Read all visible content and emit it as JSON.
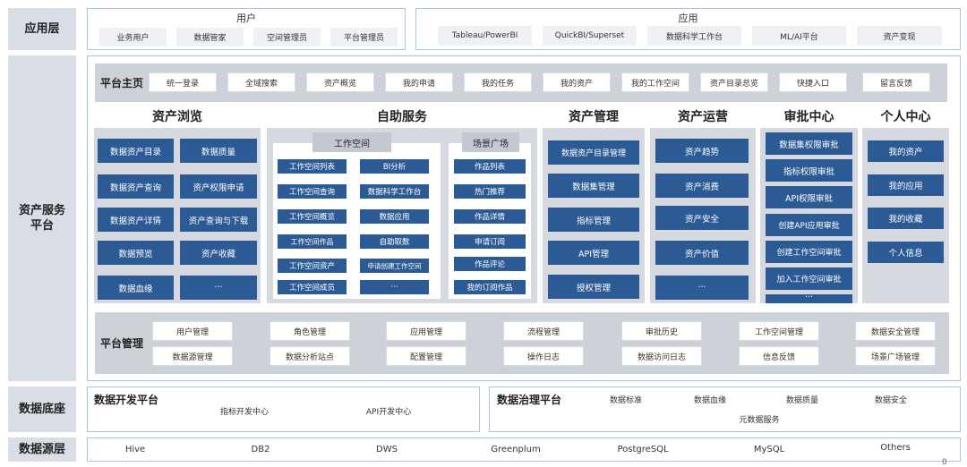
{
  "layers": {
    "app": "应用层",
    "asset_service": "资产服务\n平台",
    "data_base": "数据底座",
    "data_source": "数据源层"
  },
  "users": {
    "title": "用户",
    "items": [
      "业务用户",
      "数据管家",
      "空间管理员",
      "平台管理员"
    ]
  },
  "apps": {
    "title": "应用",
    "items": [
      "Tableau/PowerBI",
      "QuickBI/Superset",
      "数据科学工作台",
      "ML/AI平台",
      "资产变现"
    ]
  },
  "portal": {
    "title": "平台主页",
    "items": [
      "统一登录",
      "全域搜索",
      "资产概览",
      "我的申请",
      "我的任务",
      "我的资产",
      "我的工作空间",
      "资产目录总览",
      "快捷入口",
      "留言反馈"
    ]
  },
  "sections": {
    "browse": {
      "title": "资产浏览",
      "items": [
        "数据资产目录",
        "数据质量",
        "数据资产查询",
        "资产权限申请",
        "数据资产详情",
        "资产查询与下载",
        "数据预览",
        "资产收藏",
        "数据血缘",
        "···"
      ]
    },
    "self_service": {
      "title": "自助服务",
      "workspace": {
        "title": "工作空间",
        "items": [
          "工作空间列表",
          "BI分析",
          "工作空间查询",
          "数据科学工作台",
          "工作空间概览",
          "数据应用",
          "工作空间作品",
          "自助取数",
          "工作空间资产",
          "申请创建工作空间",
          "工作空间成员",
          "···"
        ]
      },
      "scene": {
        "title": "场景广场",
        "items": [
          "作品列表",
          "热门推荐",
          "作品详情",
          "申请订阅",
          "作品评论",
          "我的订阅作品"
        ]
      }
    },
    "asset_mgmt": {
      "title": "资产管理",
      "items": [
        "数据资产目录管理",
        "数据集管理",
        "指标管理",
        "API管理",
        "授权管理"
      ]
    },
    "asset_ops": {
      "title": "资产运营",
      "items": [
        "资产趋势",
        "资产消费",
        "资产安全",
        "资产价值",
        "···"
      ]
    },
    "approval": {
      "title": "审批中心",
      "items": [
        "数据集权限审批",
        "指标权限审批",
        "API权限审批",
        "创建API应用审批",
        "创建工作空间审批",
        "加入工作空间审批",
        "···"
      ]
    },
    "personal": {
      "title": "个人中心",
      "items": [
        "我的资产",
        "我的应用",
        "我的收藏",
        "个人信息"
      ]
    }
  },
  "platform_mgmt": {
    "title": "平台管理",
    "row1": [
      "用户管理",
      "角色管理",
      "应用管理",
      "流程管理",
      "审批历史",
      "工作空间管理",
      "数据安全管理"
    ],
    "row2": [
      "数据源管理",
      "数据分析站点",
      "配置管理",
      "操作日志",
      "数据访问日志",
      "信息反馈",
      "场景广场管理"
    ]
  },
  "dev_platform": {
    "title": "数据开发平台",
    "items": [
      "指标开发中心",
      "API开发中心"
    ]
  },
  "gov_platform": {
    "title": "数据治理平台",
    "items": [
      "数据标准",
      "数据血缘",
      "数据质量",
      "数据安全",
      "元数据服务"
    ]
  },
  "sources": [
    "Hive",
    "DB2",
    "DWS",
    "Greenplum",
    "PostgreSQL",
    "MySQL",
    "Others"
  ],
  "corner_mark": "0"
}
